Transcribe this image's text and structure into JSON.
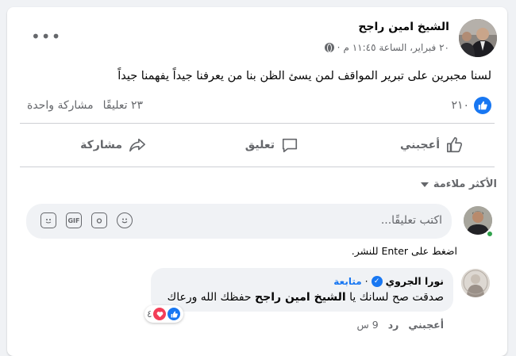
{
  "post": {
    "author": "الشيخ امين راجح",
    "date_time": "٢٠ فبراير، الساعة ١١:٤٥ م",
    "privacy_icon": "globe-icon",
    "text": "لسنا مجبرين على تبرير المواقف  لمن يسئ الظن بنا من يعرفنا جيداً يفهمنا جيداً",
    "likes_count": "٢١٠",
    "comments_count": "٢٣ تعليقًا",
    "shares_count": "مشاركة واحدة"
  },
  "actions": {
    "like": "أعجبني",
    "comment": "تعليق",
    "share": "مشاركة"
  },
  "comments_sort": "الأكثر ملاءمة",
  "comment_box": {
    "placeholder": "اكتب تعليقًا...",
    "hint": "اضغط على Enter للنشر.",
    "gif_label": "GIF"
  },
  "reply": {
    "commenter": "نورا الجروي",
    "follow": "متابعة",
    "text_before": "صدقت صح لسانك يا ",
    "text_mention": "الشيخ امين راجح",
    "text_after": " حفظك الله ورعاك",
    "reactions_count": "٤",
    "like_action": "أعجبني",
    "reply_action": "رد",
    "time": "9 س"
  },
  "colors": {
    "accent": "#1877f2",
    "muted_text": "#65676b",
    "bubble_bg": "#f0f2f5",
    "love": "#f33e58"
  }
}
